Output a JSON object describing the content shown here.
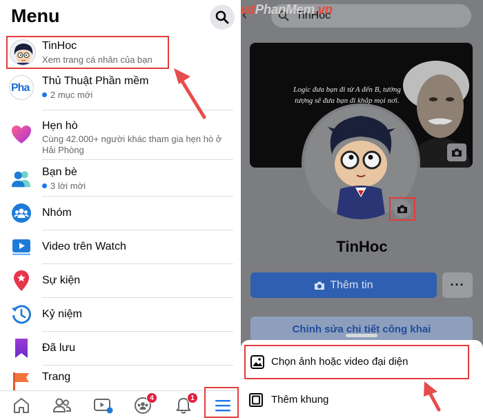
{
  "left_panel": {
    "title": "Menu",
    "profile": {
      "name": "TinHoc",
      "subtitle": "Xem trang cá nhân của bạn"
    },
    "pages": [
      {
        "name": "Thủ Thuật Phần mềm",
        "sub": "2 mục mới",
        "avatar_text": "Pha"
      }
    ],
    "items": [
      {
        "label": "Hẹn hò",
        "sub": "Cùng 42.000+ người khác tham gia hẹn hò ở Hải Phòng",
        "icon": "dating-heart-icon"
      },
      {
        "label": "Bạn bè",
        "sub": "3 lời mời",
        "icon": "friends-icon"
      },
      {
        "label": "Nhóm",
        "sub": "",
        "icon": "groups-icon"
      },
      {
        "label": "Video trên Watch",
        "sub": "",
        "icon": "watch-icon"
      },
      {
        "label": "Sự kiện",
        "sub": "",
        "icon": "events-icon"
      },
      {
        "label": "Kỷ niệm",
        "sub": "",
        "icon": "memories-icon"
      },
      {
        "label": "Đã lưu",
        "sub": "",
        "icon": "saved-icon"
      },
      {
        "label": "Trang",
        "sub": "",
        "icon": "pages-icon"
      }
    ],
    "tabbar": {
      "groups_badge": "4",
      "notifications_badge": "1"
    }
  },
  "right_panel": {
    "search_text": "TinHoc",
    "watermark": {
      "part1": "ThuThuat",
      "part2": "PhanMem",
      "part3": ".vn"
    },
    "cover_quote": "Logic đưa bạn đi từ A đến B, tưởng tượng sẽ đưa bạn đi khắp mọi nơi.",
    "profile_name": "TinHoc",
    "add_story_label": "Thêm tin",
    "more_label": "···",
    "edit_details_label": "Chỉnh sửa chi tiết công khai",
    "sheet": {
      "option1": "Chọn ảnh hoặc video đại diện",
      "option2": "Thêm khung"
    }
  },
  "colors": {
    "facebook_blue": "#1877f2",
    "highlight_red": "#e23b3b",
    "badge_red": "#e41e3f"
  }
}
